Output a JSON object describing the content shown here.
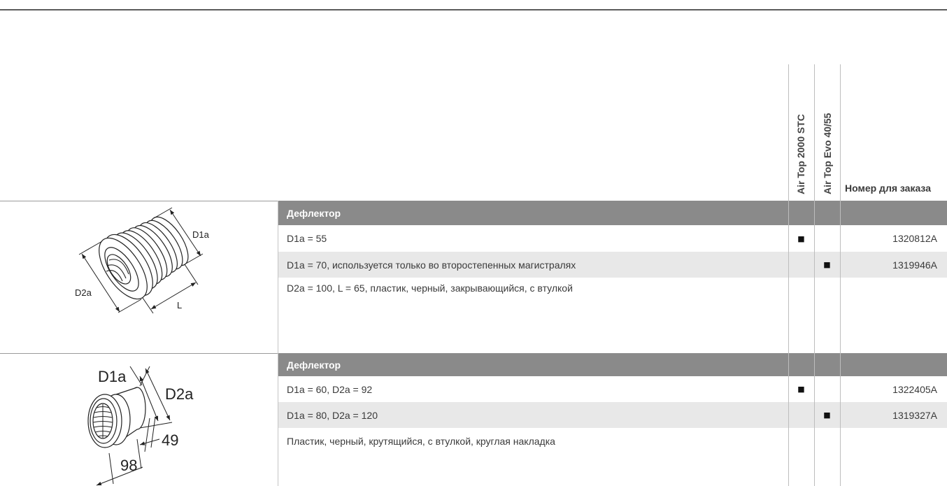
{
  "page": {
    "colors": {
      "section_bar": "#8a8a8a",
      "stripe_row": "#e8e8e8",
      "rule": "#5c5c5c"
    }
  },
  "header": {
    "col_air_top_2000": "Air Top 2000 STC",
    "col_air_top_evo": "Air Top Evo 40/55",
    "col_order_number": "Номер для заказа"
  },
  "marker": "■",
  "sections": [
    {
      "title": "Дефлектор",
      "drawing": {
        "icon": "deflector-closable-drawing",
        "labels": {
          "d1a": "D1a",
          "d2a": "D2a",
          "l": "L"
        }
      },
      "rows": [
        {
          "text": "D1a = 55",
          "air_top_2000": true,
          "air_top_evo": false,
          "order_number": "1320812A"
        },
        {
          "text": "D1a = 70, используется только во второстепенных магистралях",
          "air_top_2000": false,
          "air_top_evo": true,
          "order_number": "1319946A"
        }
      ],
      "note": "D2a = 100, L = 65, пластик, черный, закрывающийся, с втулкой"
    },
    {
      "title": "Дефлектор",
      "drawing": {
        "icon": "deflector-rotating-drawing",
        "labels": {
          "d1a": "D1a",
          "d2a": "D2a",
          "dim_49": "49",
          "dim_98": "98"
        }
      },
      "rows": [
        {
          "text": "D1a = 60, D2a = 92",
          "air_top_2000": true,
          "air_top_evo": false,
          "order_number": "1322405A"
        },
        {
          "text": "D1a = 80, D2a = 120",
          "air_top_2000": false,
          "air_top_evo": true,
          "order_number": "1319327A"
        }
      ],
      "note": "Пластик, черный, крутящийся, с втулкой, круглая накладка"
    }
  ]
}
